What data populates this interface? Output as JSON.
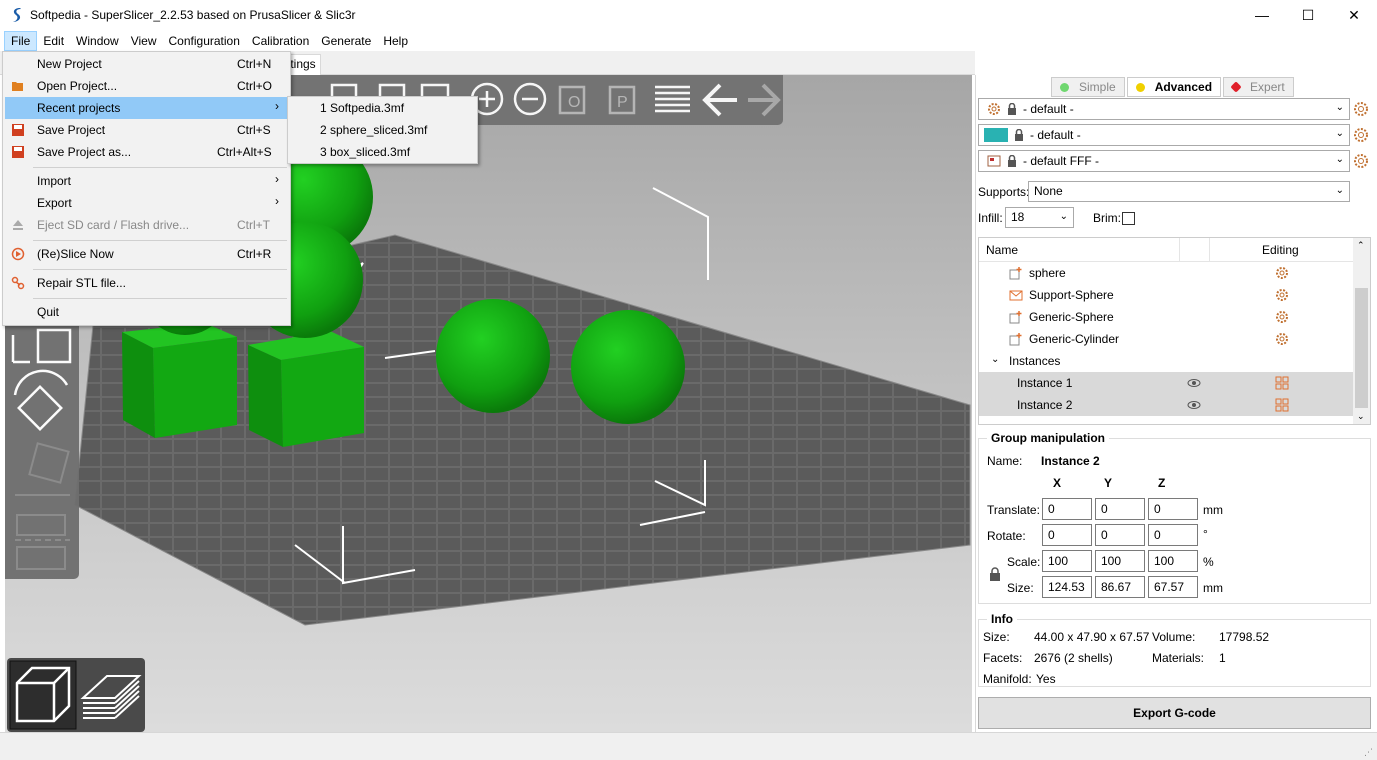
{
  "window": {
    "title": "Softpedia - SuperSlicer_2.2.53 based on PrusaSlicer & Slic3r",
    "minimize": "—",
    "maximize": "☐",
    "close": "✕"
  },
  "menubar": [
    "File",
    "Edit",
    "Window",
    "View",
    "Configuration",
    "Calibration",
    "Generate",
    "Help"
  ],
  "tab_fragment": "ttings",
  "file_menu": {
    "new_project": {
      "label": "New Project",
      "shortcut": "Ctrl+N"
    },
    "open_project": {
      "label": "Open Project...",
      "shortcut": "Ctrl+O"
    },
    "recent_projects": {
      "label": "Recent projects",
      "arrow": "›"
    },
    "save_project": {
      "label": "Save Project",
      "shortcut": "Ctrl+S"
    },
    "save_project_as": {
      "label": "Save Project as...",
      "shortcut": "Ctrl+Alt+S"
    },
    "import": {
      "label": "Import",
      "arrow": "›"
    },
    "export": {
      "label": "Export",
      "arrow": "›"
    },
    "eject": {
      "label": "Eject SD card / Flash drive...",
      "shortcut": "Ctrl+T"
    },
    "reslice": {
      "label": "(Re)Slice Now",
      "shortcut": "Ctrl+R"
    },
    "repair": {
      "label": "Repair STL file..."
    },
    "quit": {
      "label": "Quit"
    }
  },
  "recent_menu": [
    "1 Softpedia.3mf",
    "2 sphere_sliced.3mf",
    "3 box_sliced.3mf"
  ],
  "mode_tabs": {
    "simple": {
      "label": "Simple",
      "color": "#6fd76f"
    },
    "advanced": {
      "label": "Advanced",
      "color": "#f0d000"
    },
    "expert": {
      "label": "Expert",
      "color": "#e0202a"
    }
  },
  "presets": {
    "print": "- default -",
    "filament": "- default -",
    "printer": "- default FFF -",
    "filament_color": "#29b2b2"
  },
  "supports": {
    "label": "Supports:",
    "value": "None"
  },
  "infill": {
    "label": "Infill:",
    "value": "18"
  },
  "brim": {
    "label": "Brim:"
  },
  "object_list": {
    "col_name": "Name",
    "col_editing": "Editing",
    "rows": [
      {
        "name": "sphere"
      },
      {
        "name": "Support-Sphere"
      },
      {
        "name": "Generic-Sphere"
      },
      {
        "name": "Generic-Cylinder"
      }
    ],
    "instances_label": "Instances",
    "instances": [
      "Instance 1",
      "Instance 2"
    ]
  },
  "group": {
    "title": "Group manipulation",
    "name_label": "Name:",
    "name_value": "Instance 2",
    "axes": [
      "X",
      "Y",
      "Z"
    ],
    "translate_label": "Translate:",
    "translate": [
      "0",
      "0",
      "0"
    ],
    "translate_unit": "mm",
    "rotate_label": "Rotate:",
    "rotate": [
      "0",
      "0",
      "0"
    ],
    "rotate_unit": "°",
    "scale_label": "Scale:",
    "scale": [
      "100",
      "100",
      "100"
    ],
    "scale_unit": "%",
    "size_label": "Size:",
    "size": [
      "124.53",
      "86.67",
      "67.57"
    ],
    "size_unit": "mm"
  },
  "info": {
    "title": "Info",
    "size_label": "Size:",
    "size_value": "44.00 x 47.90 x 67.57",
    "volume_label": "Volume:",
    "volume_value": "17798.52",
    "facets_label": "Facets:",
    "facets_value": "2676 (2 shells)",
    "materials_label": "Materials:",
    "materials_value": "1",
    "manifold_label": "Manifold:",
    "manifold_value": "Yes"
  },
  "export_button": "Export G-code",
  "colors": {
    "object_green": "#13b313",
    "menu_highlight": "#91c9f7",
    "viewport_bg": "#b5b5b5"
  }
}
